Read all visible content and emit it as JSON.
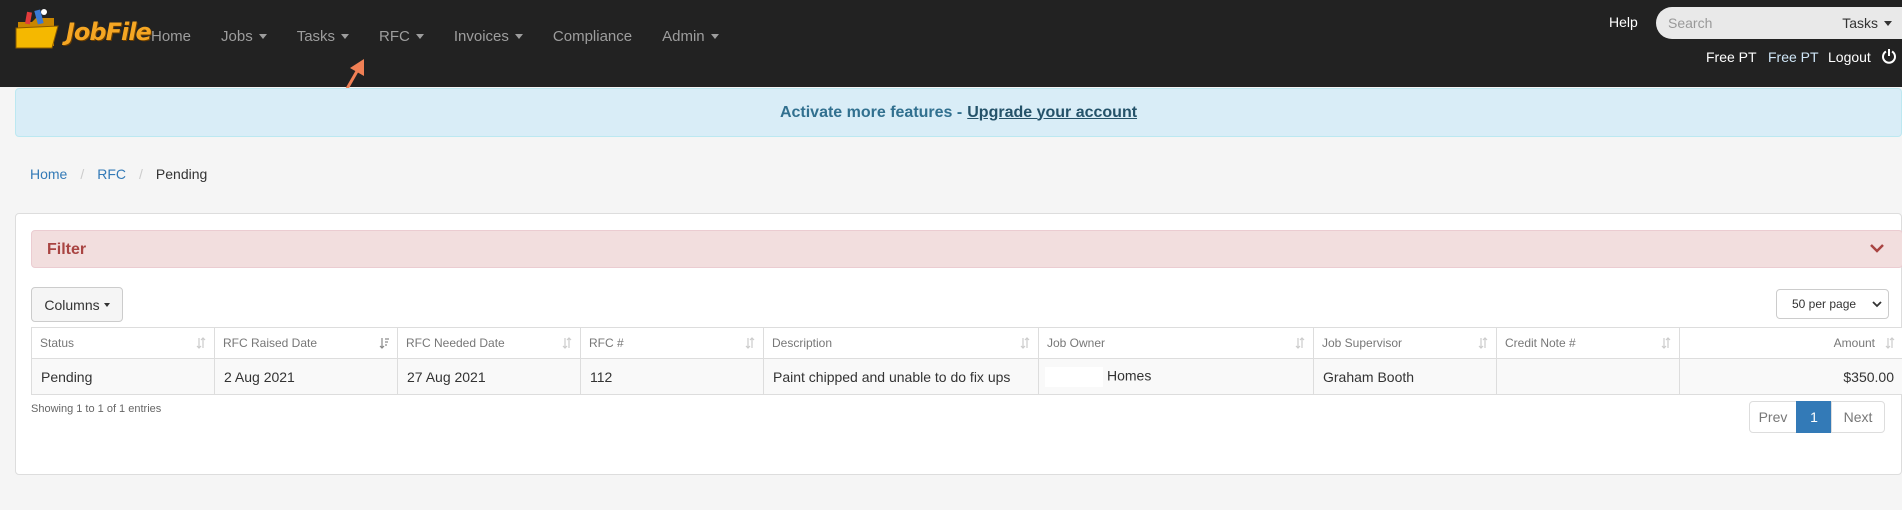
{
  "brand": {
    "name": "JobFile"
  },
  "nav": {
    "items": [
      {
        "label": "Home",
        "dropdown": false
      },
      {
        "label": "Jobs",
        "dropdown": true
      },
      {
        "label": "Tasks",
        "dropdown": true
      },
      {
        "label": "RFC",
        "dropdown": true
      },
      {
        "label": "Invoices",
        "dropdown": true
      },
      {
        "label": "Compliance",
        "dropdown": false
      },
      {
        "label": "Admin",
        "dropdown": true
      }
    ],
    "help": "Help",
    "search_placeholder": "Search",
    "search_scope": "Tasks",
    "user_primary": "Free PT",
    "user_secondary": "Free PT",
    "logout": "Logout"
  },
  "alert": {
    "text": "Activate more features -",
    "link": "Upgrade your account"
  },
  "breadcrumb": {
    "home": "Home",
    "section": "RFC",
    "current": "Pending"
  },
  "filter": {
    "title": "Filter"
  },
  "toolbar": {
    "columns_label": "Columns",
    "per_page": "50 per page"
  },
  "table": {
    "headers": {
      "status": "Status",
      "raised": "RFC Raised Date",
      "needed": "RFC Needed Date",
      "number": "RFC #",
      "description": "Description",
      "owner": "Job Owner",
      "supervisor": "Job Supervisor",
      "credit": "Credit Note #",
      "amount": "Amount"
    },
    "rows": [
      {
        "status": "Pending",
        "raised": "2 Aug 2021",
        "needed": "27 Aug 2021",
        "number": "112",
        "description": "Paint chipped and unable to do fix ups",
        "owner": "Homes",
        "supervisor": "Graham Booth",
        "credit": "",
        "amount": "$350.00"
      }
    ]
  },
  "footer": {
    "info": "Showing 1 to 1 of 1 entries",
    "prev": "Prev",
    "page": "1",
    "next": "Next"
  },
  "colors": {
    "navbar": "#222222",
    "alert_bg": "#d9edf7",
    "filter_bg": "#f2dede",
    "accent": "#337ab7",
    "annotation_arrow": "#f08055"
  }
}
